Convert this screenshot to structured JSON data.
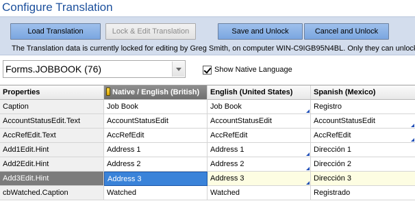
{
  "title": "Configure Translation",
  "toolbar": {
    "load_label": "Load Translation",
    "lock_edit_label": "Lock & Edit Translation",
    "save_unlock_label": "Save and Unlock",
    "cancel_unlock_label": "Cancel and Unlock",
    "lock_message": "The Translation data is currently locked for editing by Greg Smith, on computer WIN-C9IGB95N4BL. Only they can unlock it."
  },
  "form_selector": {
    "value": "Forms.JOBBOOK (76)"
  },
  "show_native": {
    "label": "Show Native Language",
    "checked": true
  },
  "grid": {
    "headers": [
      "Properties",
      "Native / English (British)",
      "English (United States)",
      "Spanish (Mexico)"
    ],
    "rows": [
      {
        "property": "Caption",
        "native": "Job Book",
        "en_us": "Job Book",
        "es_mx": "Registro"
      },
      {
        "property": "AccountStatusEdit.Text",
        "native": "AccountStatusEdit",
        "en_us": "AccountStatusEdit",
        "es_mx": "AccountStatusEdit"
      },
      {
        "property": "AccRefEdit.Text",
        "native": "AccRefEdit",
        "en_us": "AccRefEdit",
        "es_mx": "AccRefEdit"
      },
      {
        "property": "Add1Edit.Hint",
        "native": "Address 1",
        "en_us": "Address 1",
        "es_mx": "Dirección 1"
      },
      {
        "property": "Add2Edit.Hint",
        "native": "Address 2",
        "en_us": "Address 2",
        "es_mx": "Dirección 2"
      },
      {
        "property": "Add3Edit.Hint",
        "native": "Address 3",
        "en_us": "Address 3",
        "es_mx": "Dirección 3"
      },
      {
        "property": "cbWatched.Caption",
        "native": "Watched",
        "en_us": "Watched",
        "es_mx": "Registrado"
      }
    ]
  },
  "colors": {
    "title": "#1b4f9c",
    "toolbar_bg": "#d3dded",
    "button": "#7ba6e0",
    "selection": "#3a83d9"
  },
  "icons": {
    "native_column": "key-icon",
    "changed_marker": "corner-triangle-icon"
  }
}
